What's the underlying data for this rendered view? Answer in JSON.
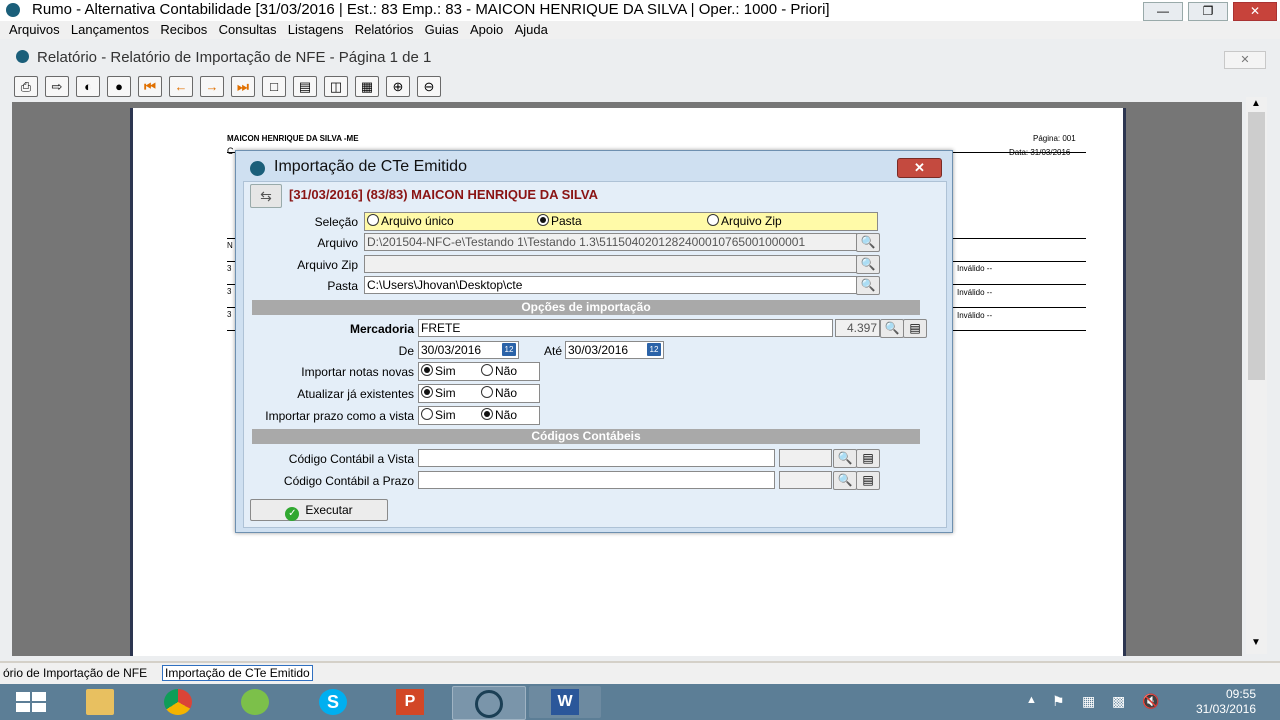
{
  "app": {
    "title": "Rumo - Alternativa Contabilidade [31/03/2016 | Est.: 83 Emp.: 83 - MAICON HENRIQUE DA SILVA | Oper.: 1000 - Priori]"
  },
  "menu": [
    "Arquivos",
    "Lançamentos",
    "Recibos",
    "Consultas",
    "Listagens",
    "Relatórios",
    "Guias",
    "Apoio",
    "Ajuda"
  ],
  "report": {
    "title": "Relatório - Relatório de Importação de NFE - Página 1 de 1",
    "page": {
      "company": "MAICON HENRIQUE DA SILVA -ME",
      "page_label": "Página: 001",
      "date_label": "Data: 31/03/2016",
      "row_marks": [
        "C",
        "N",
        "3",
        "3",
        "3"
      ],
      "right_cells": [
        "Inválido --",
        "Inválido --",
        "Inválido --"
      ]
    }
  },
  "dialog": {
    "title": "Importação de CTe Emitido",
    "context": "[31/03/2016] (83/83) MAICON HENRIQUE DA SILVA",
    "selecao": {
      "label": "Seleção",
      "options": [
        "Arquivo único",
        "Pasta",
        "Arquivo Zip"
      ],
      "selected": "Pasta"
    },
    "arquivo": {
      "label": "Arquivo",
      "value": "D:\\201504-NFC-e\\Testando 1\\Testando 1.3\\5115040201282400010765001000001"
    },
    "arquivo_zip": {
      "label": "Arquivo Zip",
      "value": ""
    },
    "pasta": {
      "label": "Pasta",
      "value": "C:\\Users\\Jhovan\\Desktop\\cte"
    },
    "section_opcoes": "Opções de importação",
    "mercadoria": {
      "label": "Mercadoria",
      "value": "FRETE",
      "code": "4.397"
    },
    "de": {
      "label": "De",
      "value": "30/03/2016"
    },
    "ate": {
      "label": "Até",
      "value": "30/03/2016"
    },
    "calendar_glyph": "12",
    "importar_novas": {
      "label": "Importar notas novas",
      "yes": "Sim",
      "no": "Não",
      "selected": "Sim"
    },
    "atualizar": {
      "label": "Atualizar já existentes",
      "yes": "Sim",
      "no": "Não",
      "selected": "Sim"
    },
    "prazo_vista": {
      "label": "Importar prazo como a vista",
      "yes": "Sim",
      "no": "Não",
      "selected": "Não"
    },
    "section_codigos": "Códigos Contábeis",
    "cod_vista": {
      "label": "Código Contábil a Vista",
      "value": "",
      "code": ""
    },
    "cod_prazo": {
      "label": "Código Contábil a Prazo",
      "value": "",
      "code": ""
    },
    "execute_label": "Executar"
  },
  "status_strip": {
    "left": "ório de Importação de NFE",
    "right": "Importação de CTe Emitido"
  },
  "taskbar": {
    "time": "09:55",
    "date": "31/03/2016"
  },
  "colors": {
    "dialog_bg": "#cfe0f1",
    "context_red": "#8a1414",
    "highlight_yellow": "#fffaa8",
    "section_gray": "#a9a9a9"
  }
}
